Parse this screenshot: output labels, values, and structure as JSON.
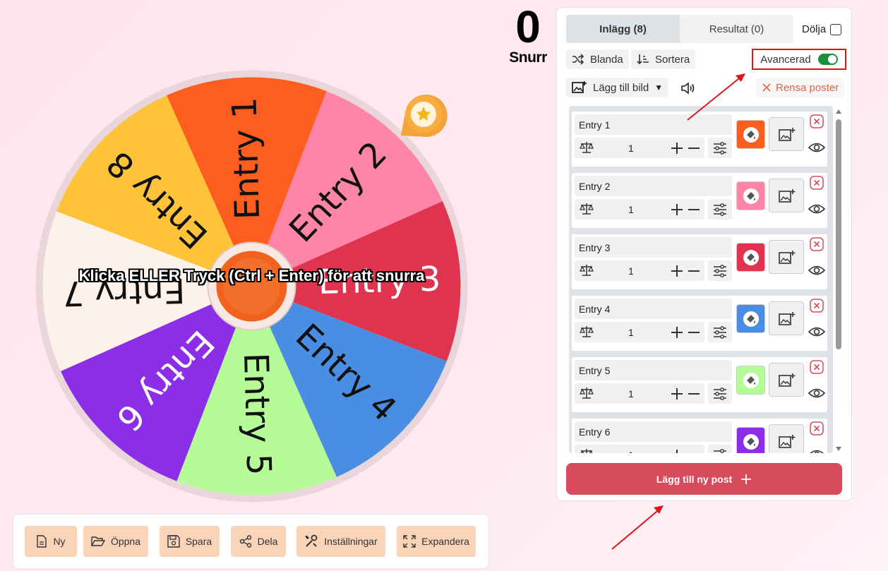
{
  "wheel": {
    "spin_prompt": "Klicka ELLER Tryck (Ctrl + Enter) för att snurra",
    "segments": [
      {
        "label": "Entry 1",
        "color": "#fe5d20",
        "text_color": "#111111"
      },
      {
        "label": "Entry 2",
        "color": "#ff85a8",
        "text_color": "#111111"
      },
      {
        "label": "Entry 3",
        "color": "#e0334f",
        "text_color": "#ffffff"
      },
      {
        "label": "Entry 4",
        "color": "#4a8ee3",
        "text_color": "#111111"
      },
      {
        "label": "Entry 5",
        "color": "#b5fc98",
        "text_color": "#111111"
      },
      {
        "label": "Entry 6",
        "color": "#8c2ee8",
        "text_color": "#ffffff"
      },
      {
        "label": "Entry 7",
        "color": "#fdf2e9",
        "text_color": "#111111"
      },
      {
        "label": "Entry 8",
        "color": "#fec339",
        "text_color": "#111111"
      }
    ]
  },
  "spin_counter": {
    "count": "0",
    "label": "Snurr"
  },
  "panel": {
    "tabs": [
      {
        "label": "Inlägg (8)",
        "active": true
      },
      {
        "label": "Resultat (0)",
        "active": false
      }
    ],
    "hide_label": "Dölja",
    "shuffle_label": "Blanda",
    "sort_label": "Sortera",
    "advanced_label": "Avancerad",
    "add_image_label": "Lägg till bild",
    "clear_label": "Rensa poster",
    "add_entry_label": "Lägg till ny post",
    "entries": [
      {
        "name": "Entry 1",
        "weight": "1",
        "color": "#fe5d20"
      },
      {
        "name": "Entry 2",
        "weight": "1",
        "color": "#ff85a8"
      },
      {
        "name": "Entry 3",
        "weight": "1",
        "color": "#e0334f"
      },
      {
        "name": "Entry 4",
        "weight": "1",
        "color": "#4a8ee3"
      },
      {
        "name": "Entry 5",
        "weight": "1",
        "color": "#b5fc98"
      },
      {
        "name": "Entry 6",
        "weight": "1",
        "color": "#8c2ee8"
      }
    ]
  },
  "toolbar": {
    "new_label": "Ny",
    "open_label": "Öppna",
    "save_label": "Spara",
    "share_label": "Dela",
    "settings_label": "Inställningar",
    "expand_label": "Expandera"
  },
  "colors": {
    "accent": "#d84b5c",
    "toolbar_button": "#f9d4b9",
    "toggle_on": "#1b8f3a",
    "annotation": "#e0141d"
  }
}
